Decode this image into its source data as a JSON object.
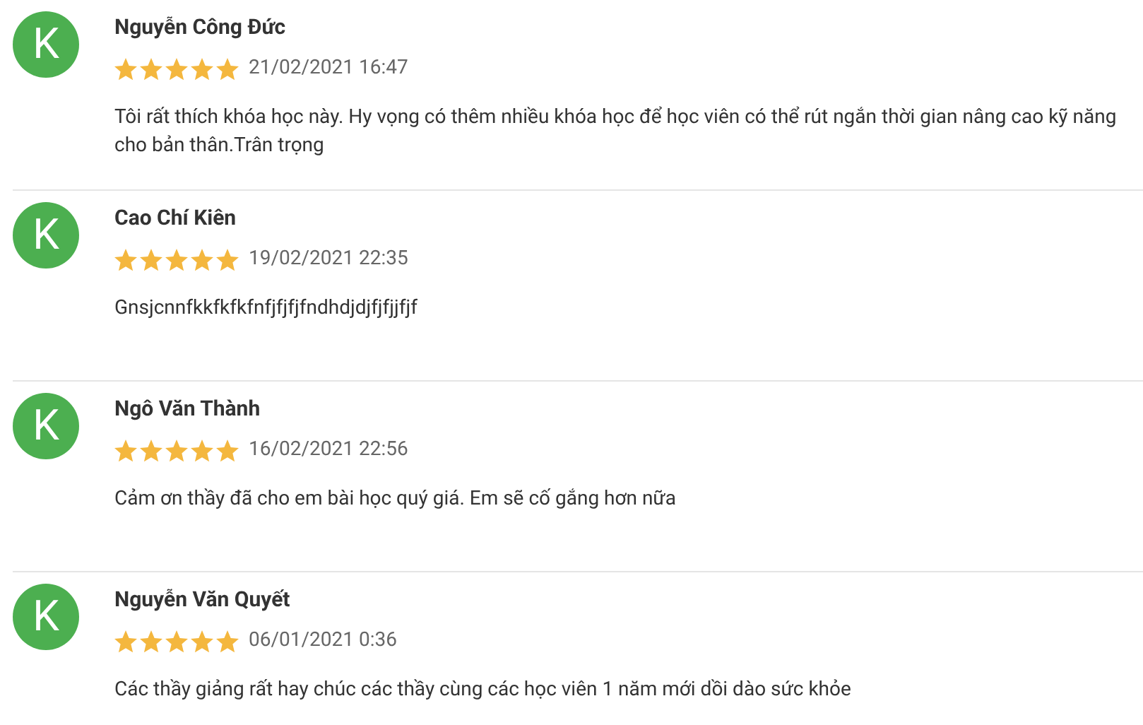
{
  "reviews": [
    {
      "avatar_letter": "K",
      "name": "Nguyễn Công Đức",
      "stars": 5,
      "date": "21/02/2021 16:47",
      "comment": "Tôi rất thích khóa học này. Hy vọng có thêm nhiều khóa học để học viên có thể rút ngắn thời gian nâng cao kỹ năng cho bản thân.Trân trọng"
    },
    {
      "avatar_letter": "K",
      "name": "Cao Chí Kiên",
      "stars": 5,
      "date": "19/02/2021 22:35",
      "comment": "Gnsjcnnfkkfkfkfnfjfjfjfndhdjdjfjfjjfjf"
    },
    {
      "avatar_letter": "K",
      "name": "Ngô Văn Thành",
      "stars": 5,
      "date": "16/02/2021 22:56",
      "comment": "Cảm ơn thầy đã cho em bài học quý giá. Em sẽ cố gắng hơn nữa"
    },
    {
      "avatar_letter": "K",
      "name": "Nguyễn Văn Quyết",
      "stars": 5,
      "date": "06/01/2021 0:36",
      "comment": "Các thầy giảng rất hay chúc các thầy cùng các học viên 1 năm mới dồi dào sức khỏe"
    }
  ]
}
